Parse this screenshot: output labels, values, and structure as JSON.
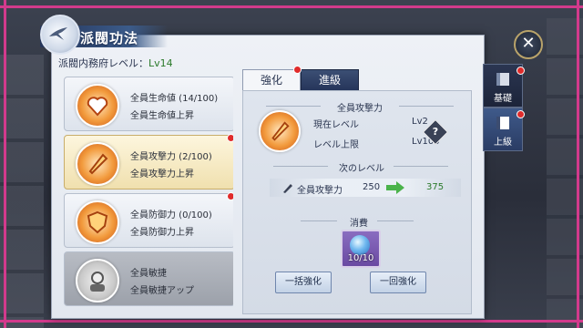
{
  "window": {
    "title": "派閥功法"
  },
  "header": {
    "level_prefix": "派閥内務府レベル：",
    "level_value": "Lv14"
  },
  "skills": [
    {
      "name": "全員生命値 (14/100)",
      "desc": "全員生命値上昇",
      "icon": "heart-icon",
      "selected": false,
      "notify": false
    },
    {
      "name": "全員攻撃力 (2/100)",
      "desc": "全員攻撃力上昇",
      "icon": "sword-icon",
      "selected": true,
      "notify": true
    },
    {
      "name": "全員防御力 (0/100)",
      "desc": "全員防御力上昇",
      "icon": "shield-icon",
      "selected": false,
      "notify": true
    },
    {
      "name": "全員敏捷",
      "desc": "全員敏捷アップ",
      "icon": "character-icon",
      "selected": false,
      "notify": false,
      "locked": true
    }
  ],
  "tabs": [
    {
      "label": "強化",
      "active": true,
      "notify": true
    },
    {
      "label": "進級",
      "active": false,
      "notify": false
    }
  ],
  "detail": {
    "section_title": "全員攻撃力",
    "current_level_label": "現在レベル",
    "current_level_value": "Lv2",
    "max_level_label": "レベル上限",
    "max_level_value": "Lv100",
    "help": "?",
    "next_title": "次のレベル",
    "stat_label": "全員攻撃力",
    "stat_current": "250",
    "stat_next": "375",
    "cost_title": "消費",
    "cost_count": "10/10",
    "bulk_button": "一括強化",
    "once_button": "一回強化"
  },
  "side_tabs": [
    {
      "label": "基礎",
      "active": false,
      "notify": true
    },
    {
      "label": "上級",
      "active": true,
      "notify": true
    }
  ],
  "colors": {
    "accent": "#2b3652",
    "highlight": "#f0e0ae",
    "next_value": "#2b7a2b",
    "notify": "#e02b2b"
  }
}
